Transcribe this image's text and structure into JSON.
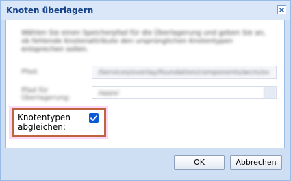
{
  "dialog": {
    "title": "Knoten überlagern",
    "description": "Wählen Sie einen Speicherpfad für die Überlagerung und geben Sie an, ob fehlende Knotenattribute den ursprünglichen Knotentypen entsprechen sollen.",
    "fields": [
      {
        "label": "Pfad:",
        "value": "/Services/overlay/foundation/components/wcm/overlay"
      },
      {
        "label": "Pfad für Überlagerung:",
        "value": "/apps/"
      }
    ],
    "match_nodetypes": {
      "label": "Knotentypen abgleichen:",
      "checked": true
    },
    "buttons": {
      "ok_label": "OK",
      "cancel_label": "Abbrechen"
    }
  },
  "colors": {
    "title_text": "#15428b",
    "highlight_border": "#c0643e",
    "highlight_glow": "#fbd8f6",
    "checkbox_fill": "#0a5ad6"
  },
  "icons": {
    "close": "close-icon",
    "checkmark": "checkmark-icon",
    "combo_trigger": "chevron-down-icon"
  }
}
